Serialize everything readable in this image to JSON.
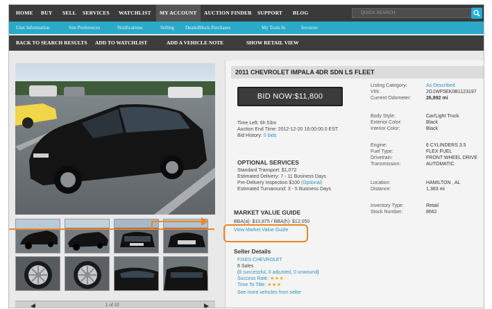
{
  "topnav": {
    "items": [
      "HOME",
      "BUY",
      "SELL",
      "SERVICES",
      "WATCHLIST",
      "MY ACCOUNT",
      "AUCTION FINDER",
      "SUPPORT",
      "BLOG"
    ],
    "search_placeholder": "QUICK SEARCH"
  },
  "subnav": {
    "items": [
      "User Information",
      "Site Preferences",
      "Notifications",
      "Selling",
      "DealerBlock Purchases",
      "My Tools In",
      "Invoices"
    ]
  },
  "actionbar": {
    "items": [
      "BACK TO SEARCH RESULTS",
      "ADD TO WATCHLIST",
      "ADD A VEHICLE NOTE",
      "SHOW RETAIL VIEW"
    ]
  },
  "gallery": {
    "counter": "1 of 32"
  },
  "vehicle": {
    "title": "2011 CHEVROLET IMPALA 4DR SDN LS FLEET",
    "bid_button": "BID NOW:$11,800",
    "time_left": "Time Left: 6h 53m",
    "auction_end": "Auction End Time: 2012-12-20 16:00:00.0 EST",
    "bid_history_label": "Bid History:",
    "bid_history_value": "0 bids"
  },
  "optional_services": {
    "heading": "OPTIONAL SERVICES",
    "lines": [
      "Standard Transport: $1,072",
      "Estimated Delivery: 7 - 11 Business Days",
      "Pre-Delivery Inspection $100",
      "Estimated Turnaround: 3 - 5 Business Days"
    ],
    "optional_tag": "(Optional)"
  },
  "market_value": {
    "heading": "MARKET VALUE GUIDE",
    "values": "BBA(a): $10,875 / BBA(h): $12,050",
    "link": "View Market Value Guide"
  },
  "seller": {
    "heading": "Seller Details",
    "name": "FIXES CHEVROLET",
    "sales": "8 Sales",
    "breakdown_open": "(",
    "successful": "8 successful",
    "adjusted": "0 adjusted",
    "unwound": "0 unwound",
    "breakdown_close": ")",
    "sep1": ", ",
    "sep2": ", ",
    "success_rate_label": "Success Rate:",
    "time_to_title_label": "Time To Title:",
    "more_link": "See more vehicles from seller"
  },
  "details": {
    "listing_category_label": "Listing Category:",
    "listing_category_value": "As Described",
    "vin_label": "VIN:",
    "vin_value": "2G1WF5EK0B1123197",
    "odometer_label": "Current Odometer:",
    "odometer_value": "26,892 mi",
    "body_style_label": "Body Style:",
    "body_style_value": "Car/Light Truck",
    "exterior_label": "Exterior Color:",
    "exterior_value": "Black",
    "interior_label": "Interior Color:",
    "interior_value": "Black",
    "engine_label": "Engine:",
    "engine_value": "6 CYLINDERS 3.5",
    "fuel_label": "Fuel Type:",
    "fuel_value": "FLEX FUEL",
    "drivetrain_label": "Drivetrain:",
    "drivetrain_value": "FRONT WHEEL DRIVE",
    "transmission_label": "Transmission:",
    "transmission_value": "AUTOMATIC",
    "location_label": "Location:",
    "location_value": "HAMILTON , AL",
    "distance_label": "Distance:",
    "distance_value": "1,383 mi",
    "inventory_label": "Inventory Type:",
    "inventory_value": "Retail",
    "stock_label": "Stock Number:",
    "stock_value": "8662"
  },
  "colors": {
    "accent": "#2aa9c9",
    "callout": "#e8862a",
    "link": "#2a92b8"
  }
}
